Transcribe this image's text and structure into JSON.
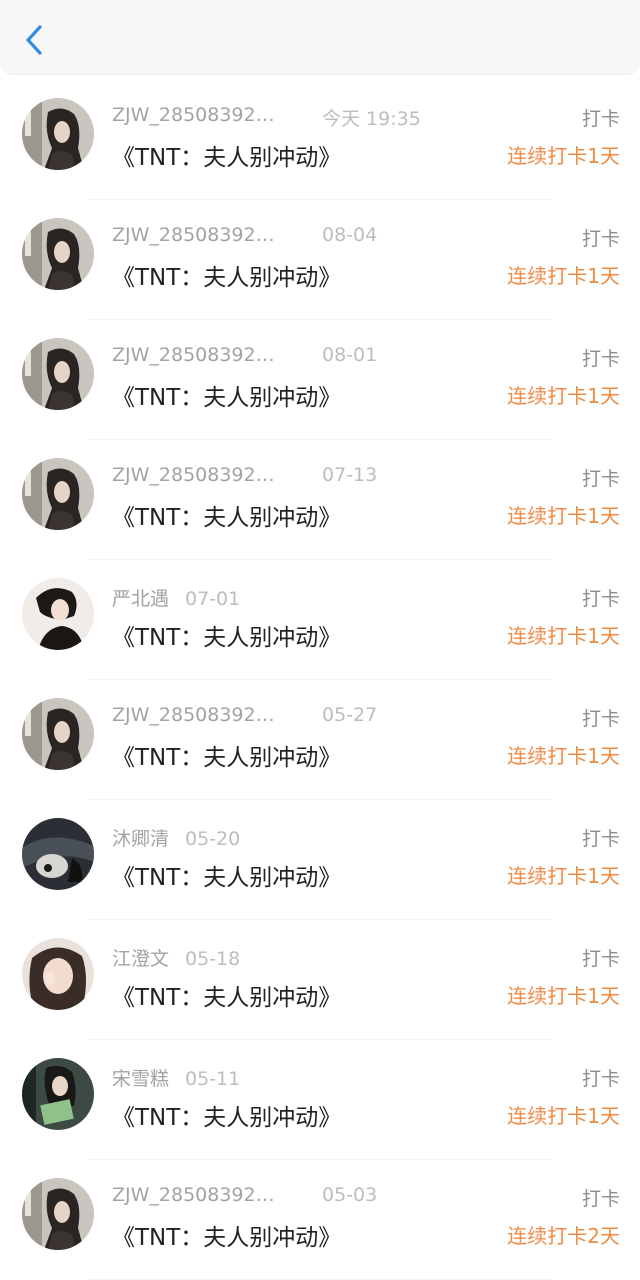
{
  "header": {
    "back_icon": "chevron-left-icon",
    "accent": "#2f8de4"
  },
  "accent_orange": "#ef8a41",
  "items": [
    {
      "name": "ZJW_28508392…",
      "date": "今天 19:35",
      "title": "《TNT：夫人别冲动》",
      "tag": "打卡",
      "streak": "连续打卡1天",
      "avatar": "a"
    },
    {
      "name": "ZJW_28508392…",
      "date": "08-04",
      "title": "《TNT：夫人别冲动》",
      "tag": "打卡",
      "streak": "连续打卡1天",
      "avatar": "a"
    },
    {
      "name": "ZJW_28508392…",
      "date": "08-01",
      "title": "《TNT：夫人别冲动》",
      "tag": "打卡",
      "streak": "连续打卡1天",
      "avatar": "a"
    },
    {
      "name": "ZJW_28508392…",
      "date": "07-13",
      "title": "《TNT：夫人别冲动》",
      "tag": "打卡",
      "streak": "连续打卡1天",
      "avatar": "a"
    },
    {
      "name": "严北遇",
      "date": "07-01",
      "title": "《TNT：夫人别冲动》",
      "tag": "打卡",
      "streak": "连续打卡1天",
      "avatar": "b"
    },
    {
      "name": "ZJW_28508392…",
      "date": "05-27",
      "title": "《TNT：夫人别冲动》",
      "tag": "打卡",
      "streak": "连续打卡1天",
      "avatar": "a"
    },
    {
      "name": "沐卿清",
      "date": "05-20",
      "title": "《TNT：夫人别冲动》",
      "tag": "打卡",
      "streak": "连续打卡1天",
      "avatar": "c"
    },
    {
      "name": "江澄文",
      "date": "05-18",
      "title": "《TNT：夫人别冲动》",
      "tag": "打卡",
      "streak": "连续打卡1天",
      "avatar": "d"
    },
    {
      "name": "宋雪糕",
      "date": "05-11",
      "title": "《TNT：夫人别冲动》",
      "tag": "打卡",
      "streak": "连续打卡1天",
      "avatar": "e"
    },
    {
      "name": "ZJW_28508392…",
      "date": "05-03",
      "title": "《TNT：夫人别冲动》",
      "tag": "打卡",
      "streak": "连续打卡2天",
      "avatar": "a"
    }
  ]
}
